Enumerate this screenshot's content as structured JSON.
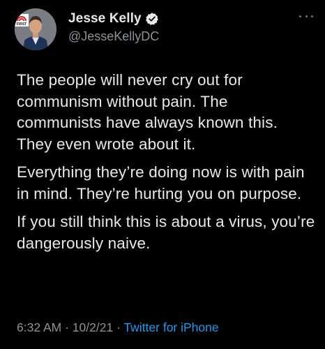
{
  "author": {
    "display_name": "Jesse Kelly",
    "handle": "@JesseKellyDC",
    "avatar_logo_text": "FIRST",
    "verified": true
  },
  "tweet": {
    "paragraphs": [
      "The people will never cry out for communism without pain. The communists have always known this. They even wrote about it.",
      "Everything they’re doing now is with pain in mind. They’re hurting you on purpose.",
      "If you still think this is about a virus, you’re dangerously naive."
    ]
  },
  "meta": {
    "time": "6:32 AM",
    "separator": "·",
    "date": "10/2/21",
    "source": "Twitter for iPhone"
  },
  "colors": {
    "background": "#000000",
    "text": "#e7e9ea",
    "muted": "#8b9298",
    "link": "#1d9bf0",
    "verified": "#e7e9ea"
  },
  "icons": {
    "verified": "verified-badge-icon",
    "more": "more-options-icon"
  }
}
